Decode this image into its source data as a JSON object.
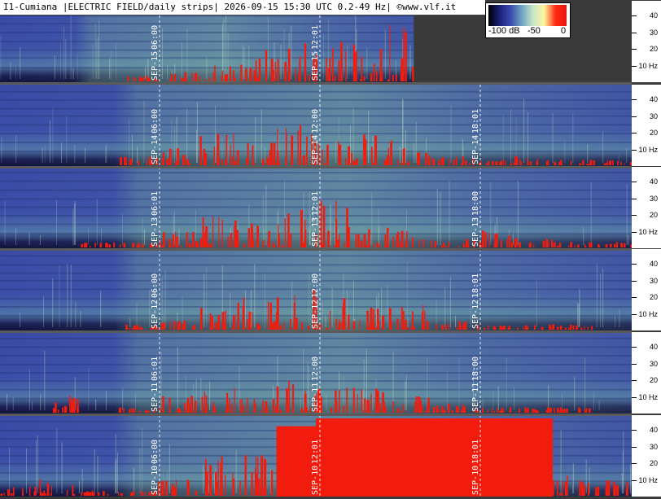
{
  "header": {
    "title": "I1-Cumiana |ELECTRIC FIELD/daily strips| 2026-09-15 15:30 UTC 0.2-49 Hz| ©www.vlf.it"
  },
  "colorbar": {
    "labels": [
      "-100 dB",
      "-50",
      "0"
    ],
    "stops": [
      "#000000",
      "#1a1f7a",
      "#3a4cb0",
      "#6fa6c0",
      "#c8e6c8",
      "#fff59a",
      "#ff2a10",
      "#e8140c"
    ]
  },
  "colors": {
    "background_dark": "#3a3a3a",
    "noise_blue": "#2f3f9a",
    "noise_green": "#7fb89c",
    "saturation_red": "#f21c0e",
    "gridline": "#ffffff"
  },
  "chart_data": {
    "type": "heatmap",
    "title": "I1-Cumiana |ELECTRIC FIELD/daily strips| 2026-09-15 15:30 UTC 0.2-49 Hz| ©www.vlf.it",
    "frequency_unit": "Hz",
    "frequency_range": [
      0.2,
      49
    ],
    "y_tick_values": [
      10,
      20,
      30,
      40
    ],
    "y_tick_labels": [
      "10 Hz",
      "20",
      "30",
      "40"
    ],
    "color_scale_db": [
      -100,
      0
    ],
    "strips": [
      {
        "date_label": "SEP-15",
        "time_markers": [
          "06:00",
          "12:01"
        ],
        "data_coverage_fraction": 0.655,
        "red_activity": [
          0,
          0,
          0,
          0.05,
          0.1,
          0.2,
          0.4,
          0.6,
          0.5,
          0.7,
          0.3,
          0.5,
          0.4,
          0.6,
          0.3
        ]
      },
      {
        "date_label": "SEP-14",
        "time_markers": [
          "06:00",
          "12:00",
          "18:01"
        ],
        "data_coverage_fraction": 1.0,
        "red_activity": [
          0,
          0,
          0,
          0.1,
          0.2,
          0.4,
          0.3,
          0.5,
          0.3,
          0.4,
          0.2,
          0.1,
          0.05,
          0.1,
          0.05,
          0.05
        ]
      },
      {
        "date_label": "SEP-13",
        "time_markers": [
          "06:01",
          "12:01",
          "18:00"
        ],
        "data_coverage_fraction": 1.0,
        "red_activity": [
          0,
          0,
          0.05,
          0.05,
          0.2,
          0.4,
          0.3,
          0.5,
          0.6,
          0.3,
          0.2,
          0.1,
          0.2,
          0.1,
          0.05,
          0.05
        ]
      },
      {
        "date_label": "SEP-12",
        "time_markers": [
          "06:00",
          "12:00",
          "18:01"
        ],
        "data_coverage_fraction": 1.0,
        "red_activity": [
          0,
          0,
          0,
          0.05,
          0.1,
          0.3,
          0.4,
          0.5,
          0.4,
          0.3,
          0.3,
          0.1,
          0.05,
          0.05,
          0.05,
          0
        ]
      },
      {
        "date_label": "SEP-11",
        "time_markers": [
          "06:01",
          "12:00",
          "18:00"
        ],
        "data_coverage_fraction": 1.0,
        "red_activity": [
          0,
          0.2,
          0,
          0.05,
          0.2,
          0.3,
          0.2,
          0.4,
          0.3,
          0.3,
          0.2,
          0.1,
          0.05,
          0.05,
          0.05,
          0
        ]
      },
      {
        "date_label": "SEP-10",
        "time_markers": [
          "06:00",
          "12:01",
          "18:01"
        ],
        "data_coverage_fraction": 1.0,
        "red_activity": [
          0.1,
          0.2,
          0.05,
          0.05,
          0.2,
          0.5,
          0.5,
          0.9,
          1.0,
          1.0,
          1.0,
          1.0,
          1.0,
          1.0,
          0.3,
          0.2
        ]
      }
    ]
  }
}
